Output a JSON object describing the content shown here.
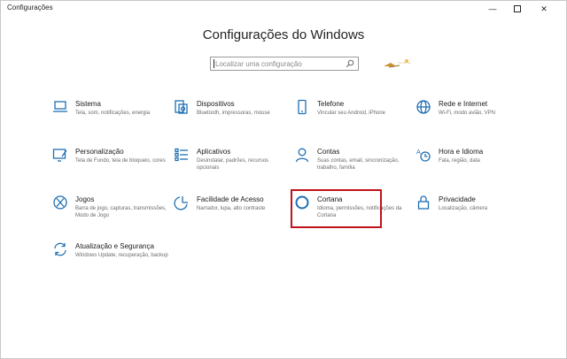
{
  "window": {
    "title": "Configurações",
    "minimize_glyph": "—",
    "close_glyph": "✕"
  },
  "header": {
    "title": "Configurações do Windows",
    "search_placeholder": "Localizar uma configuração"
  },
  "colors": {
    "accent": "#1e6fb3",
    "highlight": "#c2121a"
  },
  "items": [
    {
      "id": "sistema",
      "icon": "laptop-icon",
      "name": "Sistema",
      "desc": "Tela, som, notificações, energia"
    },
    {
      "id": "dispositivos",
      "icon": "devices-icon",
      "name": "Dispositivos",
      "desc": "Bluetooth, impressoras, mouse"
    },
    {
      "id": "telefone",
      "icon": "phone-icon",
      "name": "Telefone",
      "desc": "Vincular seu Android, iPhone"
    },
    {
      "id": "rede",
      "icon": "globe-icon",
      "name": "Rede e Internet",
      "desc": "Wi-Fi, modo avião, VPN"
    },
    {
      "id": "personalizacao",
      "icon": "personalization-icon",
      "name": "Personalização",
      "desc": "Tela de Fundo, tela de bloqueio, cores"
    },
    {
      "id": "aplicativos",
      "icon": "apps-icon",
      "name": "Aplicativos",
      "desc": "Desinstalar, padrões, recursos opcionais"
    },
    {
      "id": "contas",
      "icon": "person-icon",
      "name": "Contas",
      "desc": "Suas contas, email, sincronização, trabalho, família"
    },
    {
      "id": "hora",
      "icon": "time-language-icon",
      "name": "Hora e Idioma",
      "desc": "Fala, região, data"
    },
    {
      "id": "jogos",
      "icon": "xbox-icon",
      "name": "Jogos",
      "desc": "Barra de jogo, capturas, transmissões, Modo de Jogo"
    },
    {
      "id": "acessibilidade",
      "icon": "ease-of-access-icon",
      "name": "Facilidade de Acesso",
      "desc": "Narrador, lupa, alto contraste"
    },
    {
      "id": "cortana",
      "icon": "cortana-icon",
      "name": "Cortana",
      "desc": "Idioma, permissões, notificações da Cortana"
    },
    {
      "id": "privacidade",
      "icon": "lock-icon",
      "name": "Privacidade",
      "desc": "Localização, câmera"
    },
    {
      "id": "atualizacao",
      "icon": "update-icon",
      "name": "Atualização e Segurança",
      "desc": "Windows Update, recuperação, backup"
    }
  ]
}
